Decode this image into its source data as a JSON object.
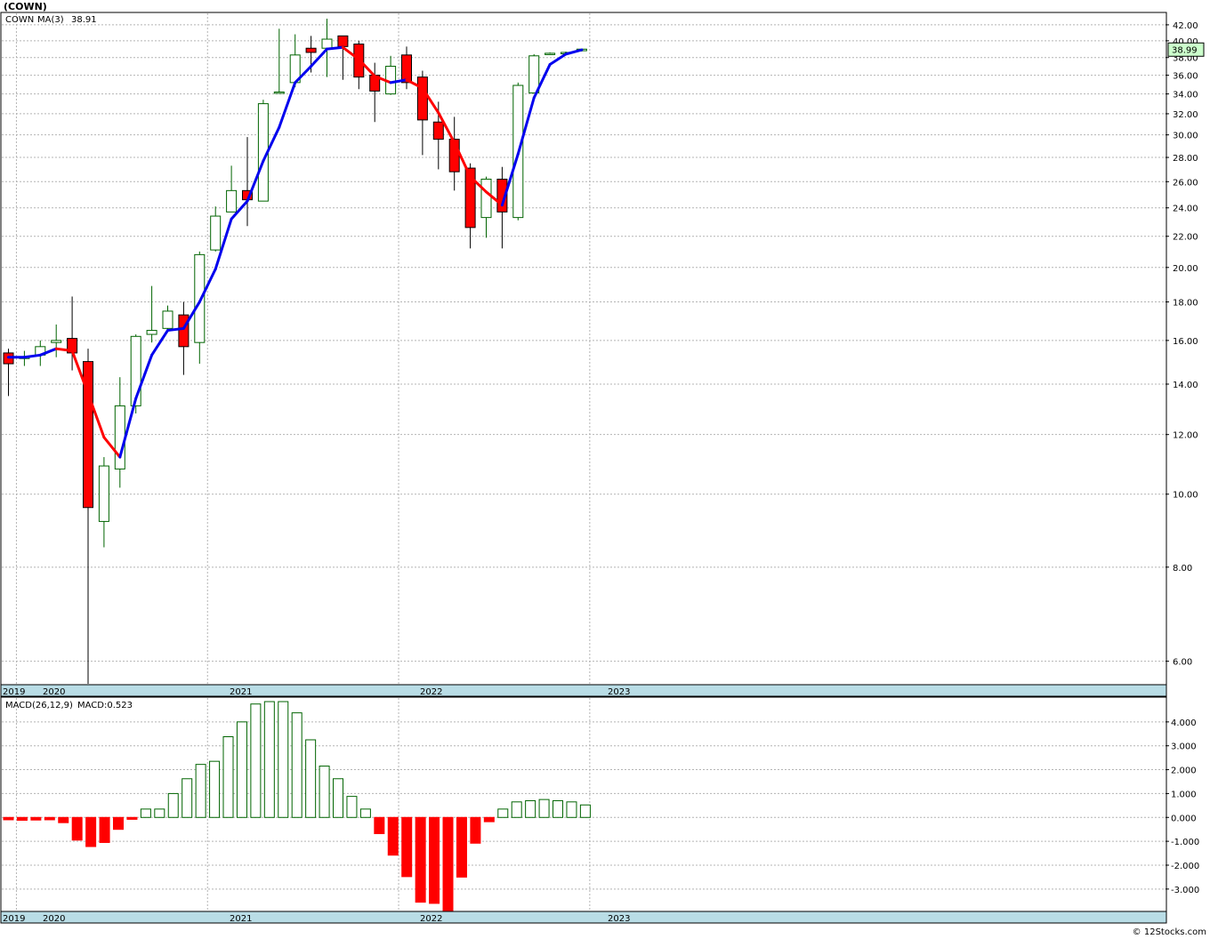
{
  "header": {
    "title": "(COWN)",
    "copyright": "© 12Stocks.com"
  },
  "price_legend": {
    "symbol": "COWN",
    "ma_label": "MA(3)",
    "ma_value": "38.91"
  },
  "macd_legend": {
    "label": "MACD(26,12,9)",
    "value_text": "MACD:0.523"
  },
  "last_price_tag": "38.99",
  "year_labels": [
    "2019",
    "2020",
    "2021",
    "2022",
    "2023"
  ],
  "colors": {
    "up": "#006400",
    "down": "#ff0000",
    "ma_up": "#0000ee",
    "ma_down": "#ff0000",
    "band": "#b9dde6",
    "grid": "#b4b4b4",
    "tag_bg": "#ccffcc"
  },
  "chart_data": [
    {
      "type": "candlestick",
      "title": "(COWN)",
      "scale": "log",
      "ylim": [
        5.6,
        43.5
      ],
      "y_ticks": [
        "6.00",
        "8.00",
        "10.00",
        "12.00",
        "14.00",
        "16.00",
        "18.00",
        "20.00",
        "22.00",
        "24.00",
        "26.00",
        "28.00",
        "30.00",
        "32.00",
        "34.00",
        "36.00",
        "38.00",
        "40.00",
        "42.00"
      ],
      "x": [
        "2019-12",
        "2020-01",
        "2020-02",
        "2020-03",
        "2020-04",
        "2020-05",
        "2020-06",
        "2020-07",
        "2020-08",
        "2020-09",
        "2020-10",
        "2020-11",
        "2020-12",
        "2021-01",
        "2021-02",
        "2021-03",
        "2021-04",
        "2021-05",
        "2021-06",
        "2021-07",
        "2021-08",
        "2021-09",
        "2021-10",
        "2021-11",
        "2021-12",
        "2022-01",
        "2022-02",
        "2022-03",
        "2022-04",
        "2022-05",
        "2022-06",
        "2022-07",
        "2022-08",
        "2022-09",
        "2022-10",
        "2022-11",
        "2022-12"
      ],
      "ohlc": [
        [
          15.4,
          15.6,
          13.5,
          14.9
        ],
        [
          15.2,
          15.5,
          14.8,
          15.2
        ],
        [
          15.3,
          16.0,
          14.8,
          15.7
        ],
        [
          15.9,
          16.8,
          15.2,
          16.0
        ],
        [
          16.1,
          18.3,
          14.6,
          15.4
        ],
        [
          15.0,
          15.6,
          5.6,
          9.6
        ],
        [
          9.2,
          11.2,
          8.5,
          10.9
        ],
        [
          10.8,
          14.3,
          10.2,
          13.1
        ],
        [
          13.1,
          16.3,
          12.8,
          16.2
        ],
        [
          16.3,
          18.9,
          15.9,
          16.5
        ],
        [
          16.6,
          17.8,
          16.4,
          17.5
        ],
        [
          17.3,
          18.0,
          14.4,
          15.7
        ],
        [
          15.9,
          21.0,
          14.9,
          20.8
        ],
        [
          21.1,
          24.1,
          21.0,
          23.4
        ],
        [
          23.7,
          27.3,
          23.7,
          25.3
        ],
        [
          25.3,
          29.8,
          22.7,
          24.6
        ],
        [
          24.5,
          33.4,
          24.5,
          33.0
        ],
        [
          34.2,
          41.5,
          34.2,
          34.2
        ],
        [
          35.2,
          40.8,
          34.7,
          38.3
        ],
        [
          39.1,
          40.6,
          36.3,
          38.6
        ],
        [
          39.1,
          42.8,
          35.8,
          40.2
        ],
        [
          40.6,
          40.6,
          35.5,
          39.3
        ],
        [
          39.6,
          40.0,
          34.5,
          35.8
        ],
        [
          36.0,
          37.4,
          31.2,
          34.3
        ],
        [
          34.0,
          38.2,
          33.9,
          37.0
        ],
        [
          38.3,
          39.3,
          34.5,
          35.2
        ],
        [
          35.8,
          36.5,
          28.2,
          31.4
        ],
        [
          31.2,
          33.2,
          27.0,
          29.6
        ],
        [
          29.6,
          31.7,
          25.3,
          26.8
        ],
        [
          27.1,
          27.5,
          21.2,
          22.6
        ],
        [
          23.3,
          26.4,
          21.9,
          26.2
        ],
        [
          26.2,
          27.2,
          21.2,
          23.7
        ],
        [
          23.3,
          35.2,
          23.1,
          34.9
        ],
        [
          34.1,
          38.4,
          34.1,
          38.2
        ],
        [
          38.5,
          38.6,
          38.3,
          38.5
        ],
        [
          38.5,
          38.7,
          38.4,
          38.6
        ],
        [
          38.8,
          39.0,
          38.7,
          38.99
        ]
      ],
      "ma": [
        15.2,
        15.2,
        15.3,
        15.6,
        15.5,
        13.6,
        11.9,
        11.2,
        13.4,
        15.3,
        16.5,
        16.6,
        18.0,
        19.9,
        23.2,
        24.5,
        27.7,
        30.7,
        35.2,
        37.0,
        39.0,
        39.2,
        37.8,
        35.9,
        35.2,
        35.5,
        34.6,
        32.1,
        29.3,
        26.4,
        25.2,
        24.2,
        28.3,
        33.6,
        37.2,
        38.4,
        38.91
      ]
    },
    {
      "type": "bar",
      "title": "MACD(26,12,9)",
      "ylim": [
        -3.9,
        5.0
      ],
      "y_ticks": [
        "-3.000",
        "-2.000",
        "-1.000",
        "0.000",
        "1.000",
        "2.000",
        "3.000",
        "4.000"
      ],
      "values": [
        -0.1,
        -0.12,
        -0.11,
        -0.1,
        -0.22,
        -0.95,
        -1.22,
        -1.05,
        -0.5,
        -0.08,
        0.35,
        0.35,
        1.0,
        1.62,
        2.22,
        2.35,
        3.38,
        4.0,
        4.75,
        4.85,
        4.85,
        4.38,
        3.25,
        2.15,
        1.62,
        0.88,
        0.35,
        -0.68,
        -1.58,
        -2.48,
        -3.55,
        -3.6,
        -3.9,
        -2.5,
        -1.08,
        -0.18,
        0.35,
        0.65,
        0.7,
        0.75,
        0.7,
        0.65,
        0.523
      ]
    }
  ]
}
